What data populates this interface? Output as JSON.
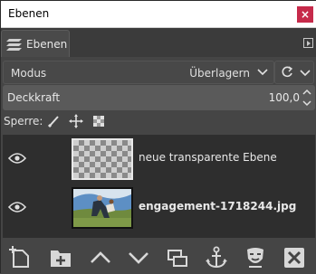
{
  "window": {
    "title": "Ebenen",
    "close_label": "×"
  },
  "tab": {
    "label": "Ebenen",
    "icon": "layers-icon",
    "menu_icon": "tab-menu-icon"
  },
  "mode": {
    "label": "Modus",
    "value": "Überlagern"
  },
  "opacity": {
    "label": "Deckkraft",
    "value": "100,0"
  },
  "lock": {
    "label": "Sperre:",
    "icons": [
      "paint-lock-icon",
      "position-lock-icon",
      "alpha-lock-icon"
    ]
  },
  "layers": [
    {
      "name": "neue transparente Ebene",
      "visible": true,
      "thumbnail": "transparent",
      "active": false
    },
    {
      "name": "engagement-1718244.jpg",
      "visible": true,
      "thumbnail": "photo",
      "active": true
    }
  ],
  "toolbar": {
    "icons": [
      "new-layer-icon",
      "new-layer-group-icon",
      "raise-layer-icon",
      "lower-layer-icon",
      "duplicate-layer-icon",
      "anchor-layer-icon",
      "layer-mask-icon",
      "delete-layer-icon"
    ]
  },
  "colors": {
    "panel": "#454545",
    "list_bg": "#2e2e2e",
    "close": "#c62a4a",
    "text": "#e8e8e8"
  }
}
